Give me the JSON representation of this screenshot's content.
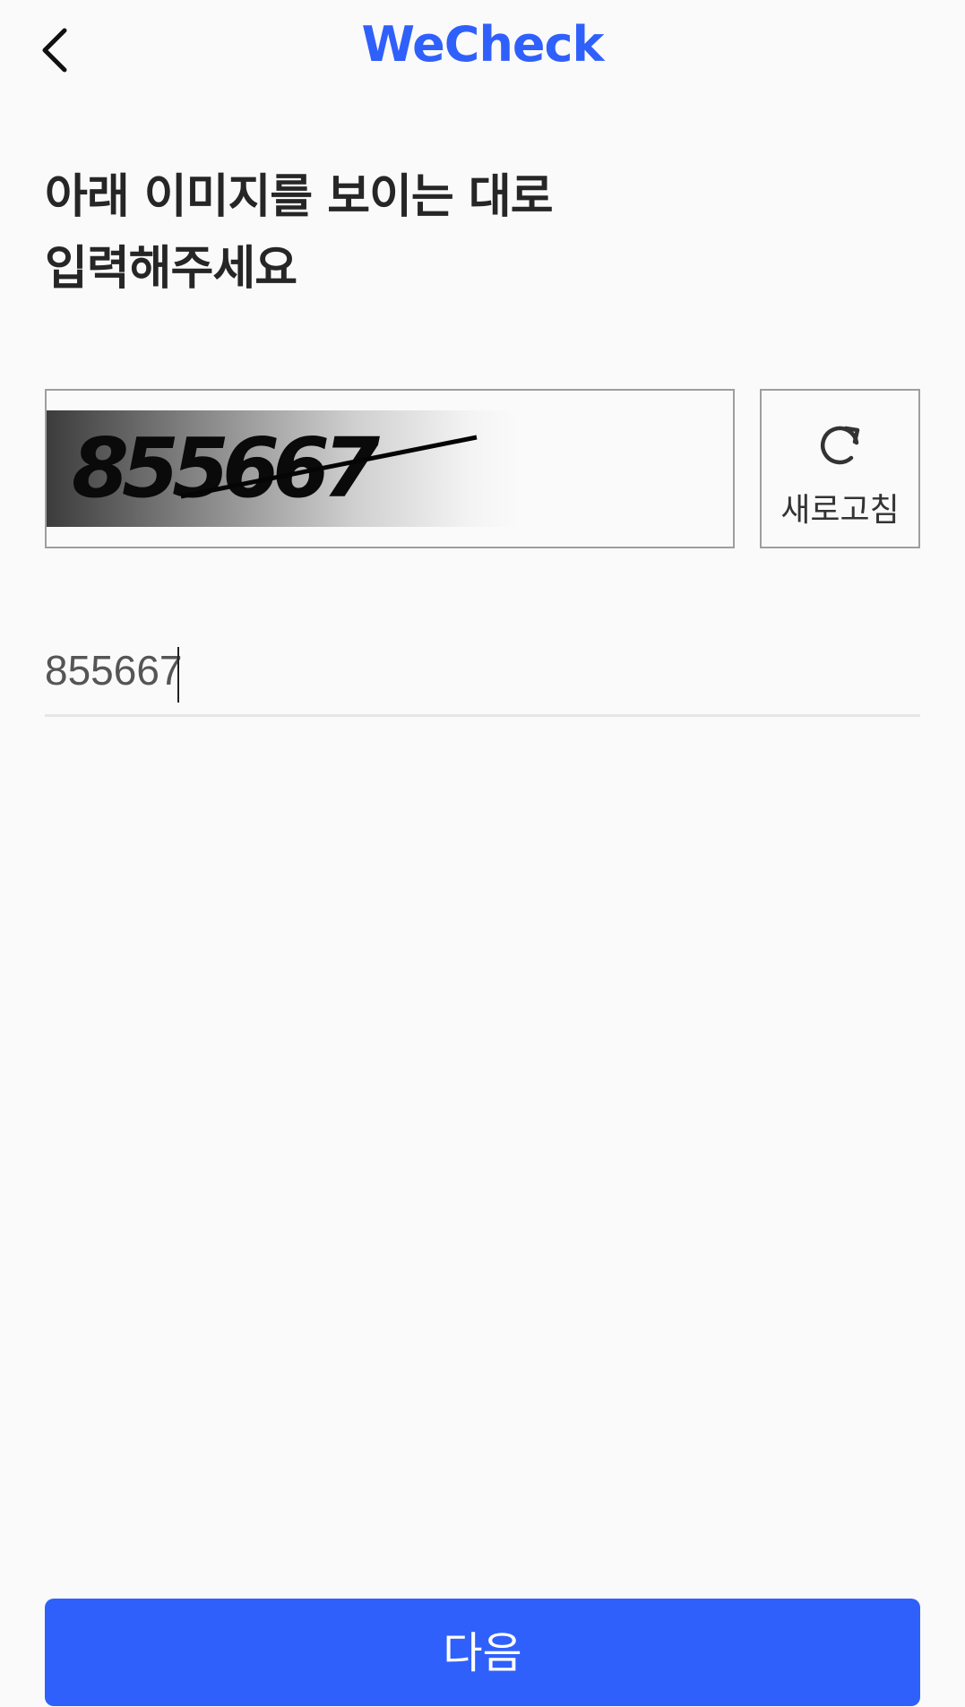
{
  "header": {
    "back_icon": "chevron-left-icon",
    "brand": "WeCheck"
  },
  "title": {
    "line1": "아래 이미지를 보이는 대로",
    "line2": "입력해주세요"
  },
  "captcha": {
    "image_text": "855667",
    "refresh_icon": "refresh-icon",
    "refresh_label": "새로고침"
  },
  "input": {
    "value": "855667"
  },
  "footer": {
    "next_label": "다음"
  },
  "colors": {
    "brand": "#3060fb",
    "button": "#3060fb",
    "background": "#fafafa"
  }
}
